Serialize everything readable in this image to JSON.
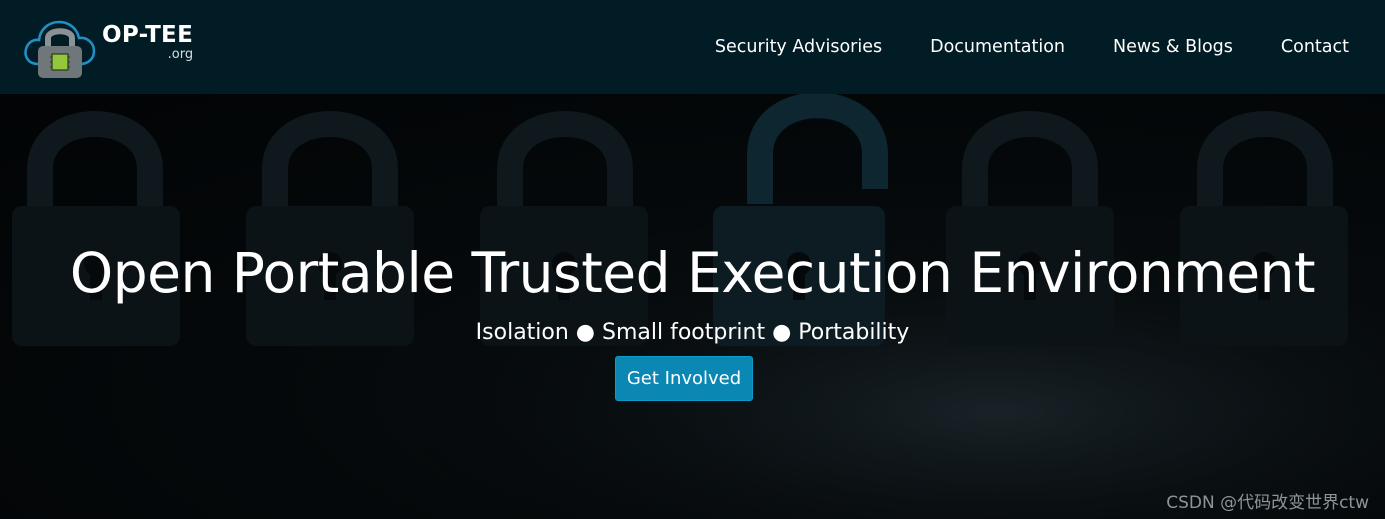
{
  "brand": {
    "name": "OP-TEE",
    "domain": ".org",
    "icon": "cloud-lock-icon"
  },
  "nav": {
    "items": [
      {
        "label": "Security Advisories"
      },
      {
        "label": "Documentation"
      },
      {
        "label": "News & Blogs"
      },
      {
        "label": "Contact"
      }
    ]
  },
  "hero": {
    "title": "Open Portable Trusted Execution Environment",
    "tagline": "Isolation ● Small footprint ● Portability",
    "cta_label": "Get Involved"
  },
  "watermark": "CSDN @代码改变世界ctw",
  "colors": {
    "navbar_bg": "#011c25",
    "cta_bg": "#0b87b3",
    "cloud_outline": "#1f8fc4",
    "chip_green": "#93c83e"
  }
}
